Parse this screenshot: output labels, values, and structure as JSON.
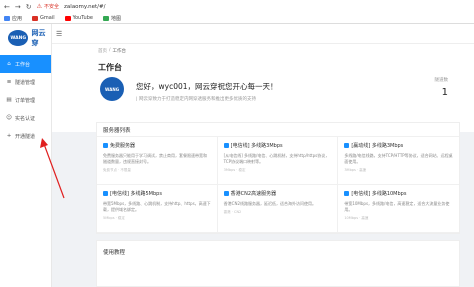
{
  "browser": {
    "security_label": "不安全",
    "url": "zalaomy.net/#/",
    "bookmarks": [
      {
        "label": "应用",
        "color": "#4285f4"
      },
      {
        "label": "Gmail",
        "color": "#d93025"
      },
      {
        "label": "YouTube",
        "color": "#ff0000"
      },
      {
        "label": "地图",
        "color": "#34a853"
      }
    ]
  },
  "sidebar": {
    "logo_mark": "WANG",
    "logo_text": "网云穿",
    "items": [
      {
        "label": "工作台",
        "icon": "home-icon",
        "glyph": "⌂",
        "active": true
      },
      {
        "label": "隧道管理",
        "icon": "tunnel-icon",
        "glyph": "≡"
      },
      {
        "label": "订单管理",
        "icon": "order-icon",
        "glyph": "▤"
      },
      {
        "label": "实名认证",
        "icon": "verify-icon",
        "glyph": "☺"
      },
      {
        "label": "开通隧道",
        "icon": "plus-icon",
        "glyph": "+"
      }
    ]
  },
  "header": {
    "crumb_home": "首页",
    "crumb_sep": "/",
    "crumb_current": "工作台",
    "title": "工作台",
    "avatar": "WANG",
    "greeting": "您好，wyc001，网云穿祝您开心每一天！",
    "greeting_sub": "| 网云穿致力于打造稳定内网穿透服务和推出更多优质的支持",
    "stat_label": "隧道数",
    "stat_value": "1"
  },
  "servers": {
    "title": "服务器列表",
    "items": [
      {
        "name": "免费服务器",
        "desc": "免费服务器只能用于学习调试，禁止商用，套餐限速带宽和隧道数量，违规直接封号。",
        "foot": "免费节点 · 不限量"
      },
      {
        "name": "[电信线] 多线路3Mbps",
        "desc": "[从电信线] 多线路/电信、心跳机制，支持http/https协议，TCP协议端口映射等。",
        "foot": "3Mbps · 稳定"
      },
      {
        "name": "[赢动线] 多线路3Mbps",
        "desc": "多线路/电信线路，支持TCP/HTTP等协议，适合网站、远程桌面使用。",
        "foot": "3Mbps · 高速"
      },
      {
        "name": "[电信线] 多线路5Mbps",
        "desc": "带宽5Mbps，多线路、心跳机制，支持http、https，高速下载，提供域名绑定。",
        "foot": "5Mbps · 稳定"
      },
      {
        "name": "香港CN2高速服务器",
        "desc": "香港CN2线路服务器，延迟低，适合海外访问使用。",
        "foot": "香港 · CN2"
      },
      {
        "name": "[电信线] 多线路10Mbps",
        "desc": "带宽10Mbps，多线路/电信，高速稳定，适合大流量业务使用。",
        "foot": "10Mbps · 高速"
      }
    ]
  },
  "tutorial": {
    "title": "使用教程"
  }
}
